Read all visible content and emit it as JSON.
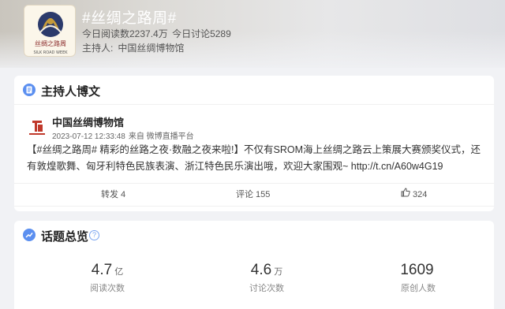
{
  "header": {
    "title": "#丝绸之路周#",
    "reads": "今日阅读数2237.4万",
    "discussions": "今日讨论5289",
    "host_label": "主持人:",
    "host_name": "中国丝绸博物馆",
    "logo_text_cn": "丝绸之路周",
    "logo_text_en": "SILK ROAD WEEK"
  },
  "host_post": {
    "section_title": "主持人博文",
    "author": "中国丝绸博物馆",
    "timestamp": "2023-07-12 12:33:48",
    "source": "来自 微博直播平台",
    "text": "【#丝绸之路周# 精彩的丝路之夜·数融之夜来啦!】不仅有SROM海上丝绸之路云上策展大赛颁奖仪式，还有敦煌歌舞、匈牙利特色民族表演、浙江特色民乐演出哦，欢迎大家围观~ http://t.cn/A60w4G19 http://t.cn/A60w4...",
    "repost_label": "转发 4",
    "comment_label": "评论 155",
    "like_count": "324"
  },
  "overview": {
    "section_title": "话题总览",
    "help": "?",
    "stats": [
      {
        "value": "4.7",
        "unit": "亿",
        "label": "阅读次数"
      },
      {
        "value": "4.6",
        "unit": "万",
        "label": "讨论次数"
      },
      {
        "value": "1609",
        "unit": "",
        "label": "原创人数"
      }
    ]
  },
  "colors": {
    "accent": "#5b8ff0",
    "background": "#f1f2f5"
  }
}
